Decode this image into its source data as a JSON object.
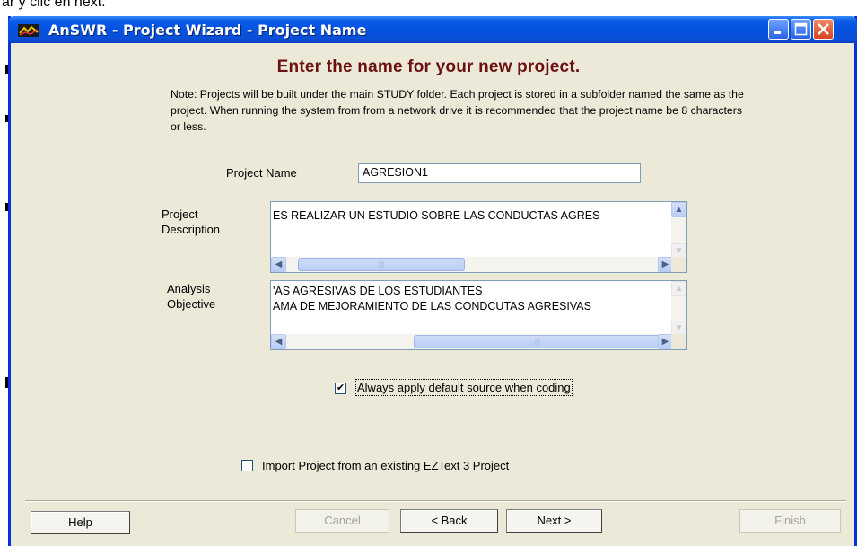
{
  "background_text": "ar y clic en next.",
  "window": {
    "title": "AnSWR - Project Wizard - Project Name",
    "controls": {
      "minimize": "minimize",
      "maximize": "maximize",
      "close": "close"
    }
  },
  "heading": "Enter the name for your new project.",
  "note": "Note: Projects will be built under the main STUDY folder. Each project is stored in a subfolder named the same as the project. When running the system from from a network drive it is recommended that the project name be 8 characters or less.",
  "fields": {
    "project_name": {
      "label": "Project Name",
      "value": "AGRESION1"
    },
    "project_description": {
      "label_line1": "Project",
      "label_line2": "Description",
      "line1": "ES REALIZAR UN ESTUDIO SOBRE LAS CONDUCTAS AGRES"
    },
    "analysis_objective": {
      "label_line1": "Analysis",
      "label_line2": "Objective",
      "line1": "'AS AGRESIVAS DE LOS ESTUDIANTES",
      "line2": "AMA DE MEJORAMIENTO DE LAS CONDCUTAS AGRESIVAS"
    }
  },
  "options": {
    "always_apply_default_source": {
      "label": "Always apply default source when coding",
      "checked": true
    },
    "import_project": {
      "label": "Import Project from an existing EZText 3 Project",
      "checked": false
    }
  },
  "buttons": {
    "help": "Help",
    "cancel": "Cancel",
    "back": "< Back",
    "next": "Next >",
    "finish": "Finish"
  },
  "colors": {
    "title_bar": "#0553e0",
    "window_bg": "#ece9d8",
    "heading": "#6b1111",
    "close_button": "#d8431f"
  }
}
